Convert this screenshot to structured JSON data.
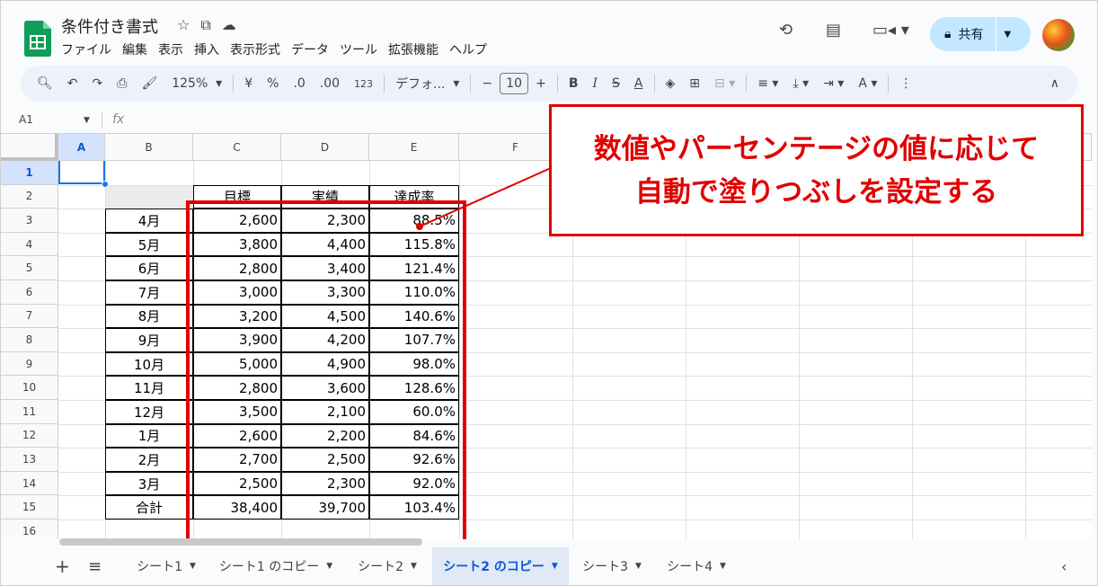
{
  "title_bar": {
    "doc_title": "条件付き書式",
    "menu": [
      "ファイル",
      "編集",
      "表示",
      "挿入",
      "表示形式",
      "データ",
      "ツール",
      "拡張機能",
      "ヘルプ"
    ],
    "share_label": "共有",
    "icons": [
      "star-icon",
      "move-folder-icon",
      "cloud-status-icon",
      "history-icon",
      "comments-icon",
      "meet-icon",
      "lock-icon"
    ]
  },
  "toolbar": {
    "zoom": "125%",
    "currency": "¥",
    "percent": "%",
    "decrease_decimals": ".0",
    "increase_decimals": ".00",
    "format_more": "123",
    "font": "デフォ...",
    "font_size": "10",
    "minus": "−",
    "plus": "+",
    "bold": "B",
    "italic": "I",
    "strike": "S",
    "text_color": "A"
  },
  "formula_bar": {
    "cell_ref": "A1",
    "fx": "fx"
  },
  "grid": {
    "columns": [
      "A",
      "B",
      "C",
      "D",
      "E",
      "F"
    ],
    "rows": [
      "1",
      "2",
      "3",
      "4",
      "5",
      "6",
      "7",
      "8",
      "9",
      "10",
      "11",
      "12",
      "13",
      "14",
      "15",
      "16"
    ],
    "header_row": [
      "目標",
      "実績",
      "達成率"
    ],
    "table": [
      {
        "month": "4月",
        "target": "2,600",
        "actual": "2,300",
        "rate": "88.5%"
      },
      {
        "month": "5月",
        "target": "3,800",
        "actual": "4,400",
        "rate": "115.8%"
      },
      {
        "month": "6月",
        "target": "2,800",
        "actual": "3,400",
        "rate": "121.4%"
      },
      {
        "month": "7月",
        "target": "3,000",
        "actual": "3,300",
        "rate": "110.0%"
      },
      {
        "month": "8月",
        "target": "3,200",
        "actual": "4,500",
        "rate": "140.6%"
      },
      {
        "month": "9月",
        "target": "3,900",
        "actual": "4,200",
        "rate": "107.7%"
      },
      {
        "month": "10月",
        "target": "5,000",
        "actual": "4,900",
        "rate": "98.0%"
      },
      {
        "month": "11月",
        "target": "2,800",
        "actual": "3,600",
        "rate": "128.6%"
      },
      {
        "month": "12月",
        "target": "3,500",
        "actual": "2,100",
        "rate": "60.0%"
      },
      {
        "month": "1月",
        "target": "2,600",
        "actual": "2,200",
        "rate": "84.6%"
      },
      {
        "month": "2月",
        "target": "2,700",
        "actual": "2,500",
        "rate": "92.6%"
      },
      {
        "month": "3月",
        "target": "2,500",
        "actual": "2,300",
        "rate": "92.0%"
      },
      {
        "month": "合計",
        "target": "38,400",
        "actual": "39,700",
        "rate": "103.4%"
      }
    ]
  },
  "sheet_tabs": [
    {
      "label": "シート1",
      "active": false
    },
    {
      "label": "シート1 のコピー",
      "active": false
    },
    {
      "label": "シート2",
      "active": false
    },
    {
      "label": "シート2 のコピー",
      "active": true
    },
    {
      "label": "シート3",
      "active": false
    },
    {
      "label": "シート4",
      "active": false
    }
  ],
  "callout": {
    "line1": "数値やパーセンテージの値に応じて",
    "line2": "自動で塗りつぶしを設定する"
  },
  "colors": {
    "accent_red": "#e00000",
    "sheets_green": "#0f9d58",
    "share_bg": "#c2e7ff",
    "selection_blue": "#1a73e8"
  }
}
